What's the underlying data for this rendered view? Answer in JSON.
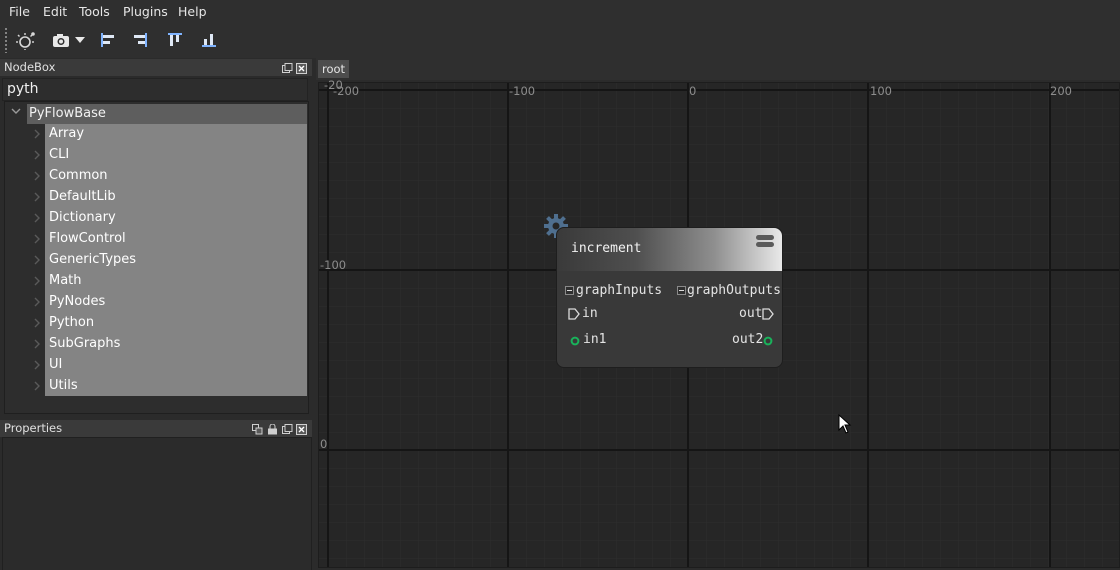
{
  "menu": [
    "File",
    "Edit",
    "Tools",
    "Plugins",
    "Help"
  ],
  "toolbar": {
    "icons": [
      "sun-bug-icon",
      "camera-icon",
      "dropdown-arrow-icon",
      "align-left-icon",
      "align-right-icon",
      "align-top-icon",
      "align-bottom-icon"
    ]
  },
  "nodebox": {
    "title": "NodeBox",
    "search_value": "pyth",
    "tree": {
      "root_label": "PyFlowBase",
      "children": [
        "Array",
        "CLI",
        "Common",
        "DefaultLib",
        "Dictionary",
        "FlowControl",
        "GenericTypes",
        "Math",
        "PyNodes",
        "Python",
        "SubGraphs",
        "UI",
        "Utils"
      ]
    }
  },
  "properties": {
    "title": "Properties"
  },
  "graph": {
    "tab_label": "root",
    "ruler_top": [
      "-200",
      "-100",
      "0",
      "100",
      "200"
    ],
    "ruler_left": [
      "-100",
      "0"
    ],
    "ruler_corner": "-20"
  },
  "node": {
    "title": "increment",
    "graph_inputs_label": "graphInputs",
    "graph_outputs_label": "graphOutputs",
    "pins": {
      "in_exec": "in",
      "out_exec": "out",
      "in_data": "in1",
      "out_data": "out2"
    }
  },
  "colors": {
    "pin_green": "#19b35b",
    "gear_blue": "#4f6f8f"
  }
}
